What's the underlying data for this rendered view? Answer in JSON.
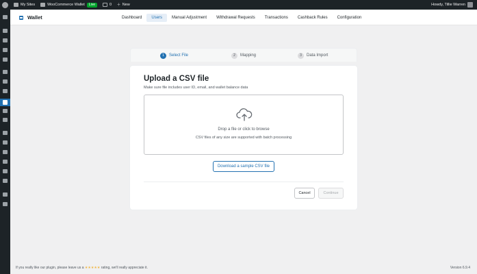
{
  "adminbar": {
    "my_sites": "My Sites",
    "site_name": "WooCommerce Wallet",
    "live_badge": "Live",
    "comments_count": "0",
    "new_label": "New",
    "user_greeting": "Howdy, Tillie Warren"
  },
  "plugin": {
    "title": "Wallet",
    "nav": [
      {
        "label": "Dashboard"
      },
      {
        "label": "Users"
      },
      {
        "label": "Manual Adjustment"
      },
      {
        "label": "Withdrawal Requests"
      },
      {
        "label": "Transactions"
      },
      {
        "label": "Cashback Rules"
      },
      {
        "label": "Configuration"
      }
    ],
    "active_tab": "Users"
  },
  "stepper": {
    "steps": [
      {
        "num": "1",
        "label": "Select File"
      },
      {
        "num": "2",
        "label": "Mapping"
      },
      {
        "num": "3",
        "label": "Data Import"
      }
    ],
    "current_step": 1
  },
  "upload": {
    "title": "Upload a CSV file",
    "subtitle": "Make sure file includes user ID, email, and wallet balance data",
    "drop_title": "Drop a file or click to browse",
    "drop_sub": "CSV files of any size are supported with batch processing",
    "sample_button": "Download a sample CSV file",
    "cancel_button": "Cancel",
    "continue_button": "Continue"
  },
  "footer": {
    "text_before": "If you really like our plugin, please leave us a",
    "stars": "★★★★★",
    "text_after": "rating, we'll really appreciate it.",
    "version": "Version 6.9.4"
  },
  "colors": {
    "accent": "#2271b1",
    "adminbar_bg": "#1d2327",
    "page_bg": "#f0f0f1",
    "live": "#00a32a",
    "star": "#f0b849"
  },
  "icons": {
    "dropzone": "cloud-upload-icon",
    "wp": "wordpress-logo-icon"
  }
}
